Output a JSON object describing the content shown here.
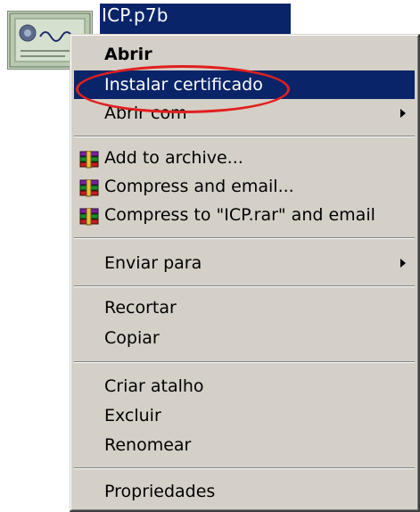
{
  "file": {
    "name": "ICP.p7b",
    "icon": "certificate-icon"
  },
  "menu": {
    "items": [
      {
        "label": "Abrir",
        "bold": true
      },
      {
        "label": "Instalar certificado",
        "highlighted": true
      },
      {
        "label": "Abrir com",
        "submenu": true
      },
      {
        "label": "Add to archive...",
        "icon": "winrar-icon"
      },
      {
        "label": "Compress and email...",
        "icon": "winrar-icon"
      },
      {
        "label": "Compress to \"ICP.rar\" and email",
        "icon": "winrar-icon"
      },
      {
        "label": "Enviar para",
        "submenu": true
      },
      {
        "label": "Recortar"
      },
      {
        "label": "Copiar"
      },
      {
        "label": "Criar atalho"
      },
      {
        "label": "Excluir"
      },
      {
        "label": "Renomear"
      },
      {
        "label": "Propriedades"
      }
    ]
  },
  "colors": {
    "menu_bg": "#d4d0c8",
    "highlight": "#0a246a",
    "annotation": "#e02020"
  }
}
